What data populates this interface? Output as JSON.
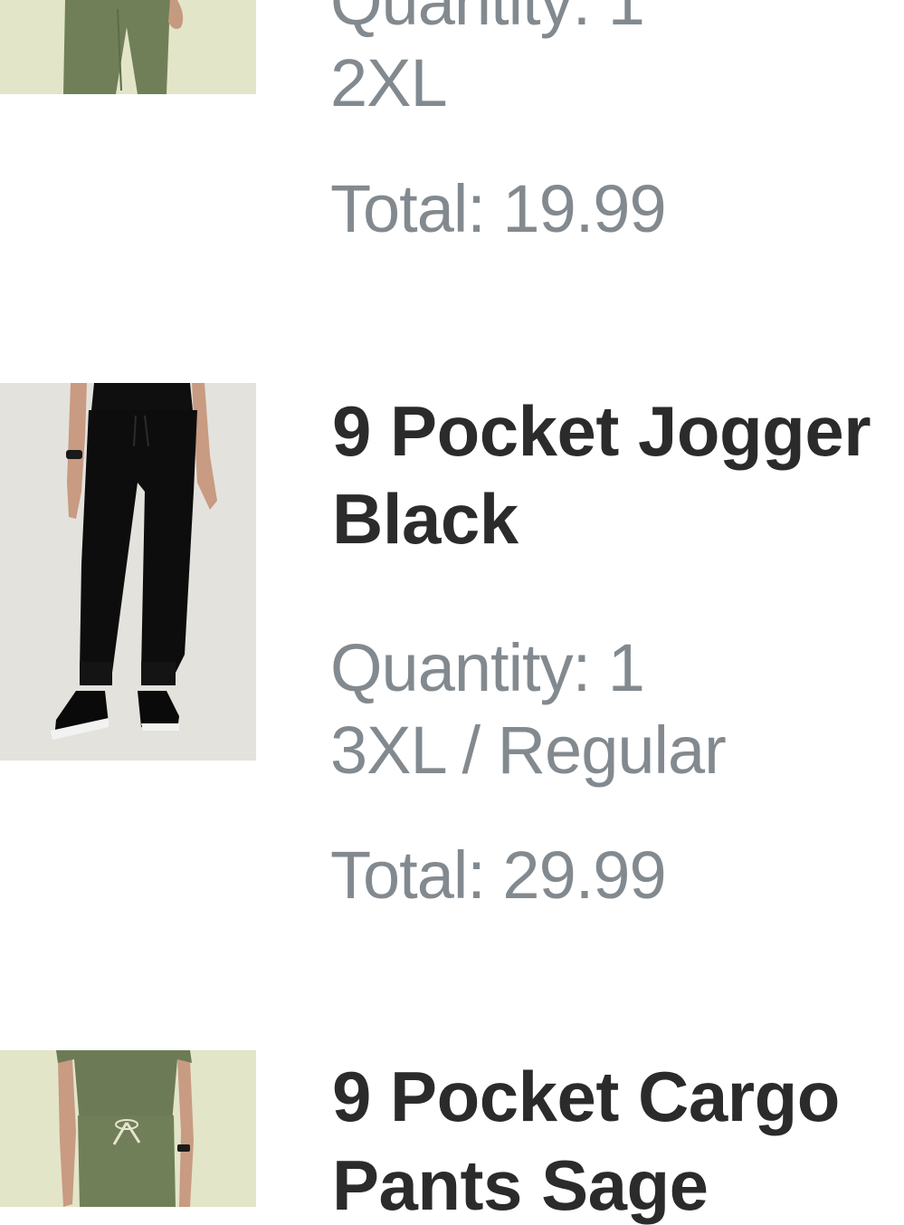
{
  "cart_items": [
    {
      "title_lines": [],
      "quantity_label": "Quantity: 1",
      "variant": "2XL",
      "total_label": "Total: 19.99",
      "image": {
        "icon": "product-photo-sage-pants",
        "background": "#e3e5c9",
        "garment": "#707f58"
      }
    },
    {
      "title_lines": [
        "9 Pocket Jogger",
        "Black"
      ],
      "quantity_label": "Quantity: 1",
      "variant": "3XL / Regular",
      "total_label": "Total: 29.99",
      "image": {
        "icon": "product-photo-black-jogger",
        "background": "#e4e2dd",
        "garment": "#0d0d0d"
      }
    },
    {
      "title_lines": [
        "9 Pocket Cargo",
        "Pants Sage"
      ],
      "quantity_label": "",
      "variant": "",
      "total_label": "",
      "image": {
        "icon": "product-photo-sage-cargo-pants",
        "background": "#e3e5c9",
        "garment": "#707f58"
      }
    }
  ],
  "colors": {
    "title": "#2b2b2b",
    "meta": "#838a8f",
    "background": "#ffffff"
  }
}
